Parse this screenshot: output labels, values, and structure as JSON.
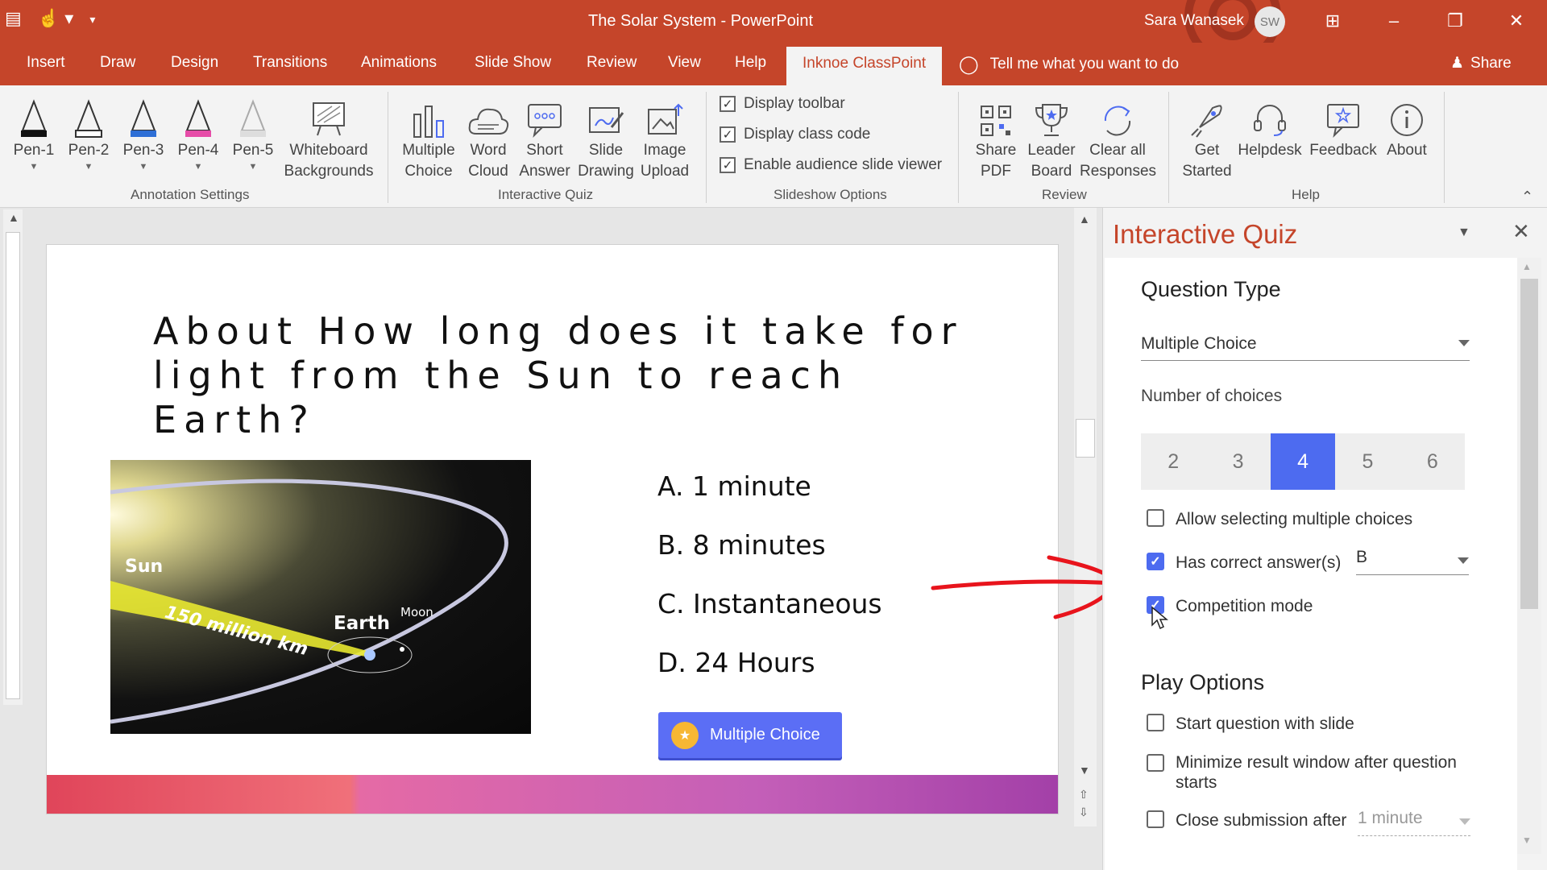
{
  "window": {
    "title": "The Solar System  -  PowerPoint",
    "user_name": "Sara Wanasek",
    "user_initials": "SW",
    "icons": [
      "present-icon",
      "touch-mode-icon",
      "customize-qat-icon",
      "ribbon-display-icon",
      "minimize-icon",
      "restore-icon",
      "close-icon"
    ]
  },
  "tabs": {
    "items": [
      "Insert",
      "Draw",
      "Design",
      "Transitions",
      "Animations",
      "Slide Show",
      "Review",
      "View",
      "Help",
      "Inknoe ClassPoint"
    ],
    "active": "Inknoe ClassPoint",
    "tell_me": "Tell me what you want to do",
    "share": "Share"
  },
  "ribbon": {
    "annotation": {
      "pens": [
        "Pen-1",
        "Pen-2",
        "Pen-3",
        "Pen-4",
        "Pen-5"
      ],
      "pen_colors": [
        "#111111",
        "#ffffff",
        "#2e6fd6",
        "#e64ca8",
        "#dddddd"
      ],
      "whiteboard_line1": "Whiteboard",
      "whiteboard_line2": "Backgrounds",
      "group": "Annotation Settings"
    },
    "quiz": {
      "buttons": [
        {
          "l1": "Multiple",
          "l2": "Choice"
        },
        {
          "l1": "Word",
          "l2": "Cloud"
        },
        {
          "l1": "Short",
          "l2": "Answer"
        },
        {
          "l1": "Slide",
          "l2": "Drawing"
        },
        {
          "l1": "Image",
          "l2": "Upload"
        }
      ],
      "group": "Interactive Quiz"
    },
    "slideshow": {
      "options": [
        "Display toolbar",
        "Display class code",
        "Enable audience slide viewer"
      ],
      "group": "Slideshow Options"
    },
    "review": {
      "buttons": [
        {
          "l1": "Share",
          "l2": "PDF"
        },
        {
          "l1": "Leader",
          "l2": "Board"
        },
        {
          "l1": "Clear all",
          "l2": "Responses"
        }
      ],
      "group": "Review"
    },
    "help": {
      "buttons": [
        {
          "l1": "Get",
          "l2": "Started"
        },
        {
          "l1": "Helpdesk",
          "l2": ""
        },
        {
          "l1": "Feedback",
          "l2": ""
        },
        {
          "l1": "About",
          "l2": ""
        }
      ],
      "group": "Help"
    }
  },
  "slide": {
    "question": "About How long does it take for light from the Sun to reach Earth?",
    "image_labels": {
      "sun": "Sun",
      "distance": "150 million km",
      "earth": "Earth",
      "moon": "Moon"
    },
    "choices": [
      "A. 1 minute",
      "B. 8 minutes",
      "C. Instantaneous",
      "D. 24 Hours"
    ],
    "badge": "Multiple Choice"
  },
  "pane": {
    "title": "Interactive Quiz",
    "question_type_heading": "Question Type",
    "question_type_value": "Multiple Choice",
    "num_choices_label": "Number of choices",
    "num_choices": [
      "2",
      "3",
      "4",
      "5",
      "6"
    ],
    "num_choices_selected": "4",
    "options": {
      "allow_multiple": {
        "label": "Allow selecting multiple choices",
        "checked": false
      },
      "has_correct": {
        "label": "Has correct answer(s)",
        "checked": true,
        "value": "B"
      },
      "competition": {
        "label": "Competition mode",
        "checked": true
      }
    },
    "play_heading": "Play Options",
    "play_options": {
      "start_with_slide": {
        "label": "Start question with slide",
        "checked": false
      },
      "minimize": {
        "label": "Minimize result window after question starts",
        "checked": false
      },
      "close_after": {
        "label": "Close submission after",
        "checked": false,
        "value": "1 minute"
      }
    }
  },
  "colors": {
    "accent": "#c5452a",
    "selection": "#4d6bf0",
    "annotation": "#e8141c"
  }
}
